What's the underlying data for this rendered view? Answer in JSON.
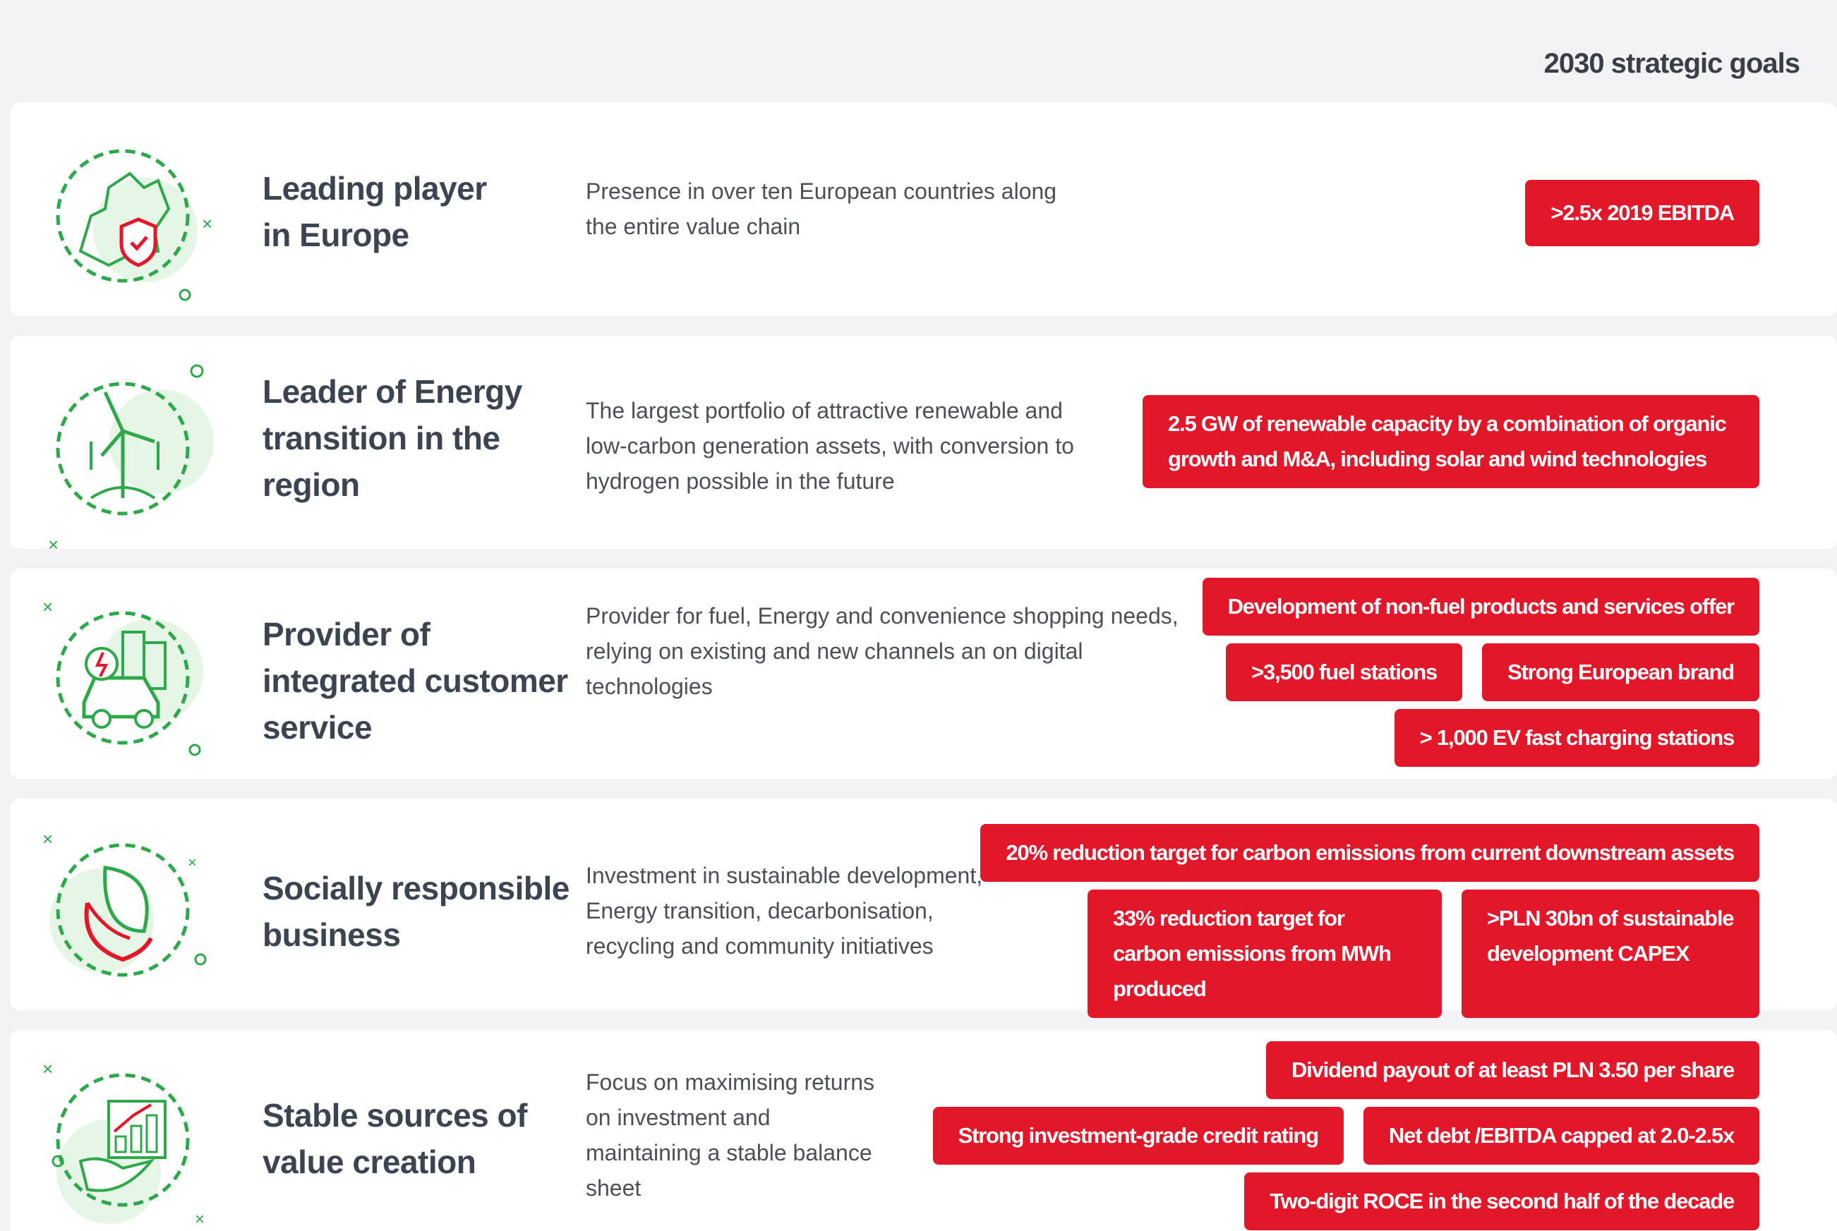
{
  "header": {
    "title": "2030 strategic goals"
  },
  "colors": {
    "accent_red": "#e3172a",
    "icon_green": "#2ea84a",
    "icon_bg": "#e5f5e6"
  },
  "cards": [
    {
      "icon": "europe-map-shield-icon",
      "title": "Leading player in Europe",
      "description": "Presence in over ten European countries along the entire value chain",
      "goals": [
        ">2.5x 2019 EBITDA"
      ]
    },
    {
      "icon": "wind-turbine-icon",
      "title": "Leader of Energy transition in the region",
      "description": "The largest portfolio of attractive renewable and low-carbon generation assets, with conversion to hydrogen possible in the future",
      "goals": [
        "2.5 GW of renewable capacity by a combination of organic growth and M&A, including solar and wind technologies"
      ]
    },
    {
      "icon": "electric-car-city-icon",
      "title": "Provider of integrated customer service",
      "description": "Provider for fuel, Energy and convenience shopping needs, relying on existing and new channels an on digital technologies",
      "goals": [
        "Development of non-fuel products and services offer",
        ">3,500 fuel stations",
        "Strong European brand",
        "> 1,000 EV fast charging stations"
      ]
    },
    {
      "icon": "leaf-hand-icon",
      "title": "Socially responsible business",
      "description": "Investment in sustainable development, Energy transition, decarbonisation, recycling and community initiatives",
      "goals": [
        "20% reduction target for carbon emissions from current downstream assets",
        "33% reduction target for carbon emissions from MWh produced",
        ">PLN 30bn of sustainable development CAPEX"
      ]
    },
    {
      "icon": "growth-chart-hand-icon",
      "title": "Stable sources of value creation",
      "description": "Focus on maximising returns on investment and maintaining a stable balance sheet",
      "goals": [
        "Dividend payout of at least PLN 3.50 per share",
        "Strong investment-grade credit rating",
        "Net debt /EBITDA capped at 2.0-2.5x",
        "Two-digit ROCE in the second half of the decade"
      ]
    }
  ]
}
